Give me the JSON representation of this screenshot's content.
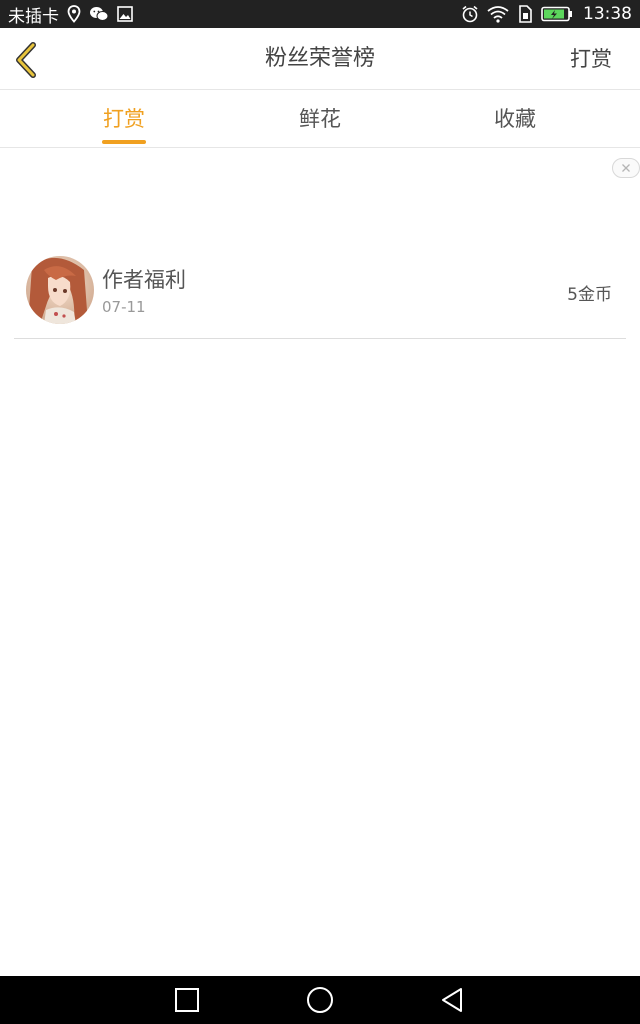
{
  "status_bar": {
    "carrier": "未插卡",
    "time": "13:38",
    "icons": [
      "location-icon",
      "wechat-icon",
      "image-icon",
      "alarm-icon",
      "wifi-icon",
      "sim-icon",
      "battery-icon"
    ]
  },
  "header": {
    "title": "粉丝荣誉榜",
    "action_label": "打赏",
    "back_icon": "chevron-left-icon"
  },
  "tabs": [
    {
      "label": "打赏",
      "active": true
    },
    {
      "label": "鲜花",
      "active": false
    },
    {
      "label": "收藏",
      "active": false
    }
  ],
  "list": [
    {
      "name": "作者福利",
      "date": "07-11",
      "amount": "5金币"
    }
  ],
  "colors": {
    "accent": "#f0a020",
    "back_icon": "#e8c43c",
    "text": "#555555",
    "subtext": "#999999",
    "status_bar": "#222222",
    "nav_bar": "#000000"
  }
}
